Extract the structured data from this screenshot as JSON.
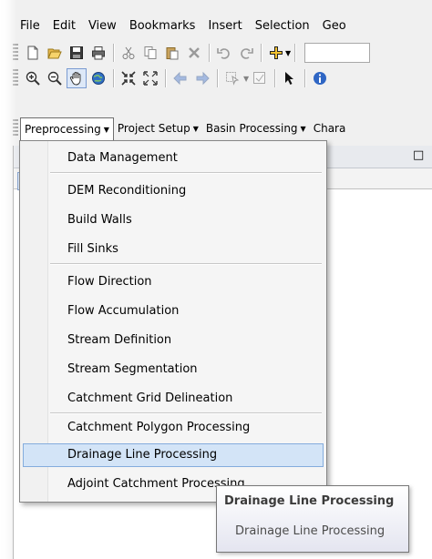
{
  "menubar": {
    "items": [
      "File",
      "Edit",
      "View",
      "Bookmarks",
      "Insert",
      "Selection",
      "Geo"
    ]
  },
  "toolbar_standard": {
    "icons": [
      "new-document-icon",
      "open-folder-icon",
      "save-icon",
      "print-icon",
      "cut-icon",
      "copy-icon",
      "paste-icon",
      "delete-icon",
      "undo-icon",
      "redo-icon",
      "add-data-icon"
    ]
  },
  "toolbar_tools": {
    "icons": [
      "zoom-in-icon",
      "zoom-out-icon",
      "pan-icon",
      "full-extent-icon",
      "fixed-zoom-in-icon",
      "fixed-zoom-out-icon",
      "back-extent-icon",
      "forward-extent-icon",
      "select-features-icon",
      "clear-selection-icon",
      "select-elements-icon",
      "identify-icon"
    ]
  },
  "extension_toolbar": {
    "menus": [
      "Preprocessing",
      "Project Setup",
      "Basin Processing",
      "Chara"
    ],
    "open_menu": "Preprocessing"
  },
  "dropdown": {
    "groups": [
      [
        "Data Management"
      ],
      [
        "DEM Reconditioning",
        "Build Walls",
        "Fill Sinks"
      ],
      [
        "Flow Direction",
        "Flow Accumulation",
        "Stream Definition",
        "Stream Segmentation",
        "Catchment Grid Delineation"
      ],
      [
        "Catchment Polygon Processing",
        "Drainage Line Processing",
        "Adjoint Catchment Processing"
      ]
    ],
    "highlighted": "Drainage Line Processing"
  },
  "tooltip": {
    "title": "Drainage Line Processing",
    "body": "Drainage Line Processing"
  },
  "colors": {
    "menu_bg": "#f5f5f5",
    "highlight_bg": "#d3e4f7",
    "highlight_border": "#84acdd",
    "chrome_bg": "#f0f0f0"
  }
}
